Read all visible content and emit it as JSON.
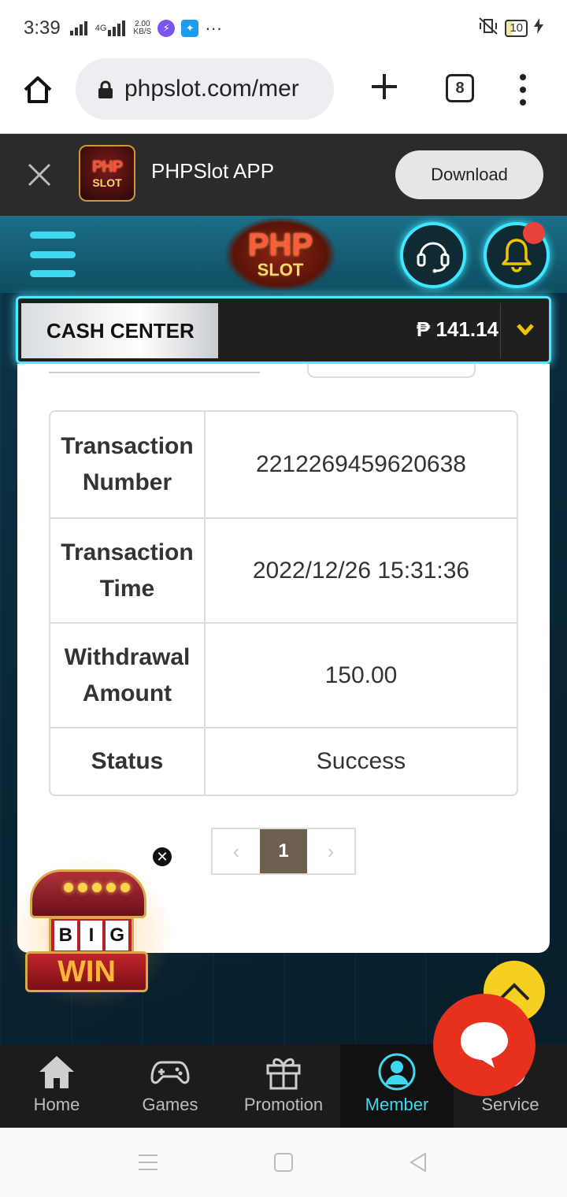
{
  "statusbar": {
    "time": "3:39",
    "network": "4G",
    "speed_value": "2.00",
    "speed_unit": "KB/S",
    "more": "···",
    "battery": "10"
  },
  "browser": {
    "url": "phpslot.com/mer",
    "tab_count": "8"
  },
  "app_banner": {
    "logo_line1": "PHP",
    "logo_line2": "SLOT",
    "app_name": "PHPSlot APP",
    "download_label": "Download"
  },
  "site_header": {
    "logo_line1": "PHP",
    "logo_line2": "SLOT"
  },
  "cash_center": {
    "label": "CASH CENTER",
    "balance": "₱ 141.14"
  },
  "transaction": {
    "rows": [
      {
        "key": "Transaction Number",
        "value": "2212269459620638"
      },
      {
        "key": "Transaction Time",
        "value": "2022/12/26 15:31:36"
      },
      {
        "key": "Withdrawal Amount",
        "value": "150.00"
      },
      {
        "key": "Status",
        "value": "Success"
      }
    ]
  },
  "pagination": {
    "prev": "‹",
    "current": "1",
    "next": "›"
  },
  "bigwin": {
    "close": "✕",
    "letters": [
      "B",
      "I",
      "G"
    ],
    "win": "WIN"
  },
  "bottom_nav": {
    "items": [
      {
        "label": "Home",
        "icon": "home-icon"
      },
      {
        "label": "Games",
        "icon": "gamepad-icon"
      },
      {
        "label": "Promotion",
        "icon": "gift-icon"
      },
      {
        "label": "Member",
        "icon": "member-icon"
      },
      {
        "label": "Service",
        "icon": "service-icon"
      }
    ],
    "active": "Member"
  },
  "colors": {
    "accent": "#3fd8f0",
    "header": "#1a6f87",
    "chat_fab": "#e8301e",
    "to_top": "#f5d020",
    "pager_active": "#6e6050"
  }
}
